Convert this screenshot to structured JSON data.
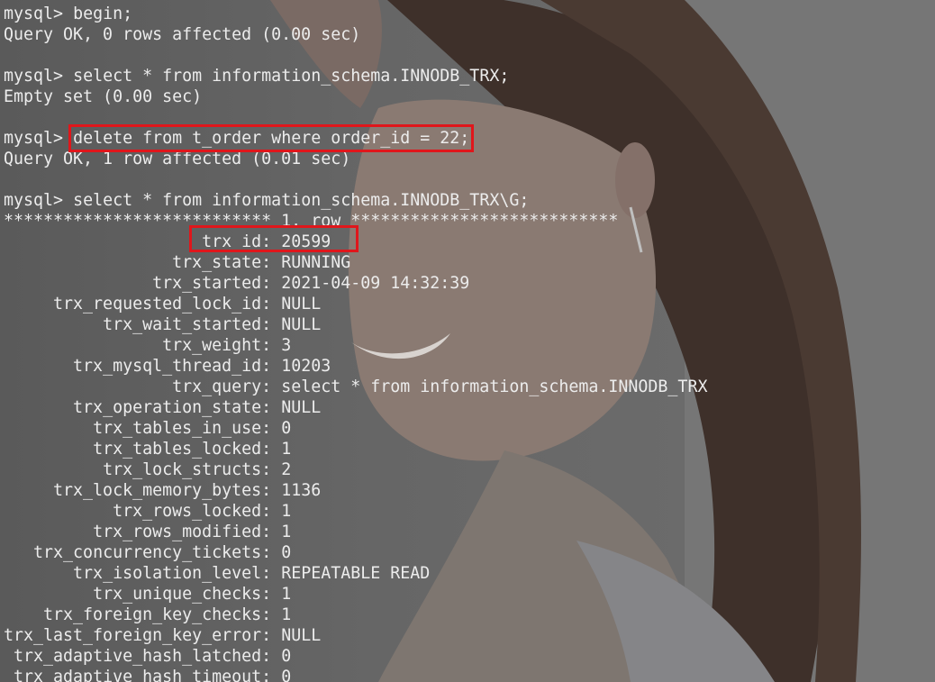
{
  "terminal": {
    "prompt": "mysql> ",
    "lines": [
      {
        "type": "cmd",
        "text": "begin;"
      },
      {
        "type": "out",
        "text": "Query OK, 0 rows affected (0.00 sec)"
      },
      {
        "type": "blank",
        "text": ""
      },
      {
        "type": "cmd",
        "text": "select * from information_schema.INNODB_TRX;"
      },
      {
        "type": "out",
        "text": "Empty set (0.00 sec)"
      },
      {
        "type": "blank",
        "text": ""
      },
      {
        "type": "cmd",
        "text": "delete from t_order where order_id = 22;",
        "highlight": true
      },
      {
        "type": "out",
        "text": "Query OK, 1 row affected (0.01 sec)"
      },
      {
        "type": "blank",
        "text": ""
      },
      {
        "type": "cmd",
        "text": "select * from information_schema.INNODB_TRX\\G;"
      },
      {
        "type": "out",
        "text": "*************************** 1. row ***************************"
      }
    ],
    "row_fields": [
      {
        "key": "trx_id",
        "value": "20599",
        "highlight": true
      },
      {
        "key": "trx_state",
        "value": "RUNNING"
      },
      {
        "key": "trx_started",
        "value": "2021-04-09 14:32:39"
      },
      {
        "key": "trx_requested_lock_id",
        "value": "NULL"
      },
      {
        "key": "trx_wait_started",
        "value": "NULL"
      },
      {
        "key": "trx_weight",
        "value": "3"
      },
      {
        "key": "trx_mysql_thread_id",
        "value": "10203"
      },
      {
        "key": "trx_query",
        "value": "select * from information_schema.INNODB_TRX"
      },
      {
        "key": "trx_operation_state",
        "value": "NULL"
      },
      {
        "key": "trx_tables_in_use",
        "value": "0"
      },
      {
        "key": "trx_tables_locked",
        "value": "1"
      },
      {
        "key": "trx_lock_structs",
        "value": "2"
      },
      {
        "key": "trx_lock_memory_bytes",
        "value": "1136"
      },
      {
        "key": "trx_rows_locked",
        "value": "1"
      },
      {
        "key": "trx_rows_modified",
        "value": "1"
      },
      {
        "key": "trx_concurrency_tickets",
        "value": "0"
      },
      {
        "key": "trx_isolation_level",
        "value": "REPEATABLE READ"
      },
      {
        "key": "trx_unique_checks",
        "value": "1"
      },
      {
        "key": "trx_foreign_key_checks",
        "value": "1"
      },
      {
        "key": "trx_last_foreign_key_error",
        "value": "NULL"
      },
      {
        "key": "trx_adaptive_hash_latched",
        "value": "0"
      },
      {
        "key": "trx_adaptive_hash_timeout",
        "value": "0"
      }
    ],
    "colors": {
      "text": "#ececec",
      "highlight_border": "#e0161b",
      "background": "#6a6a6a"
    }
  },
  "wallpaper": {
    "icon": "portrait-wallpaper-icon"
  }
}
